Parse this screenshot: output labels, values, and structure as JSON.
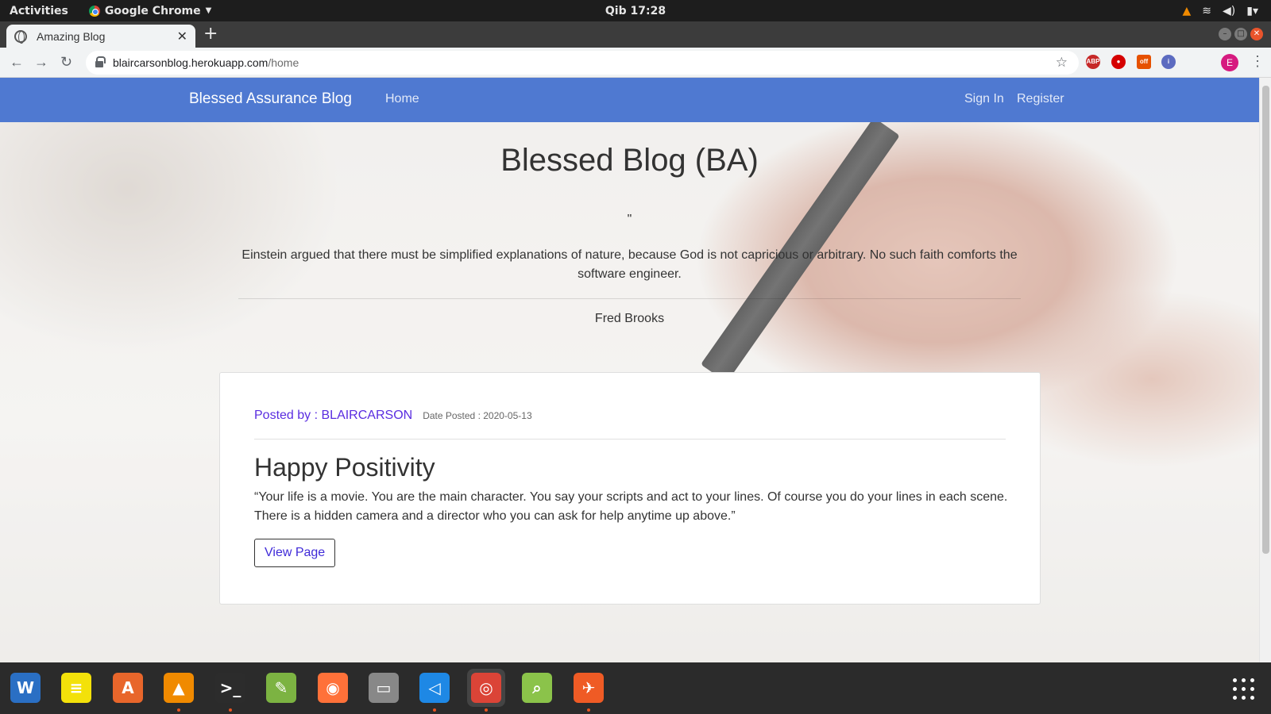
{
  "system": {
    "activities": "Activities",
    "app_name": "Google Chrome",
    "clock": "Qib 17:28"
  },
  "browser": {
    "tab_title": "Amazing Blog",
    "url_host": "blaircarsonblog.herokuapp.com",
    "url_path": "/home",
    "profile_initial": "E"
  },
  "site": {
    "brand": "Blessed Assurance Blog",
    "nav_home": "Home",
    "nav_signin": "Sign In",
    "nav_register": "Register"
  },
  "hero": {
    "title": "Blessed Blog (BA)",
    "quote_mark": "\"",
    "quote": "Einstein argued that there must be simplified explanations of nature, because God is not capricious or arbitrary. No such faith comforts the software engineer.",
    "author": "Fred Brooks"
  },
  "post": {
    "posted_by": "Posted by : BLAIRCARSON",
    "date": "Date Posted : 2020-05-13",
    "title": "Happy Positivity",
    "body": "“Your life is a movie. You are the main character. You say your scripts and act to your lines. Of course you do your lines in each scene. There is a hidden camera and a director who you can ask for help anytime up above.”",
    "button": "View Page"
  },
  "colors": {
    "navbar": "#4f79d1",
    "link_purple": "#5a2de0"
  },
  "dock": [
    {
      "name": "libreoffice-writer-icon",
      "glyph": "W",
      "color": "#2a6fc4"
    },
    {
      "name": "notes-icon",
      "glyph": "≡",
      "color": "#f3e10a"
    },
    {
      "name": "software-center-icon",
      "glyph": "A",
      "color": "#e8662b"
    },
    {
      "name": "vlc-icon",
      "glyph": "▲",
      "color": "#f08a00"
    },
    {
      "name": "terminal-icon",
      "glyph": ">_",
      "color": "#2c2c2c"
    },
    {
      "name": "text-editor-icon",
      "glyph": "✎",
      "color": "#7cb342"
    },
    {
      "name": "firefox-icon",
      "glyph": "◉",
      "color": "#ff7139"
    },
    {
      "name": "files-icon",
      "glyph": "▭",
      "color": "#888"
    },
    {
      "name": "vscode-icon",
      "glyph": "◁",
      "color": "#1e88e5"
    },
    {
      "name": "chrome-icon",
      "glyph": "◎",
      "color": "#db4437"
    },
    {
      "name": "image-viewer-icon",
      "glyph": "⌕",
      "color": "#8bc34a"
    },
    {
      "name": "postman-icon",
      "glyph": "✈",
      "color": "#ef5b25"
    }
  ]
}
